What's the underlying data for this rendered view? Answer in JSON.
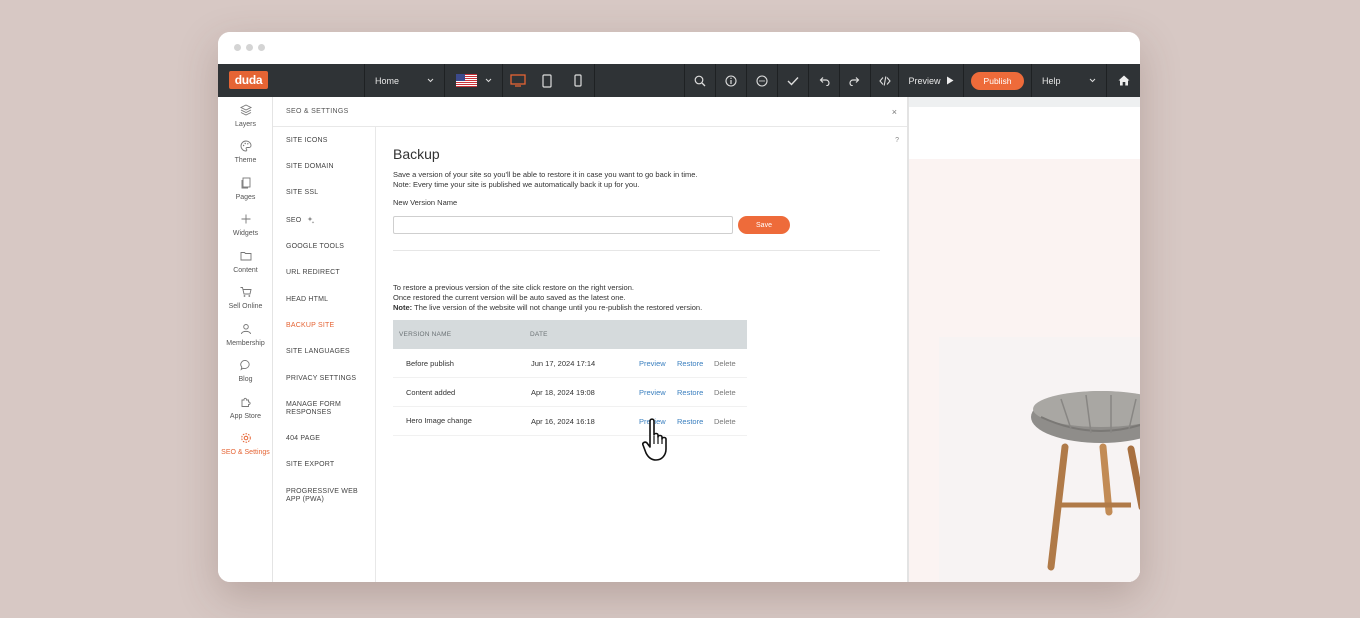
{
  "app": {
    "logo_text": "duda",
    "brand_color": "#e56434",
    "toolbar_bg": "#2f3336"
  },
  "toolbar": {
    "page_select": "Home",
    "language_flag": "us-flag-icon",
    "devices": [
      "desktop-icon",
      "tablet-icon",
      "mobile-icon"
    ],
    "preview_label": "Preview",
    "publish_label": "Publish",
    "help_label": "Help"
  },
  "sidebar": {
    "items": [
      {
        "label": "Layers",
        "icon": "layers-icon"
      },
      {
        "label": "Theme",
        "icon": "palette-icon"
      },
      {
        "label": "Pages",
        "icon": "pages-icon"
      },
      {
        "label": "Widgets",
        "icon": "plus-icon"
      },
      {
        "label": "Content",
        "icon": "folder-icon"
      },
      {
        "label": "Sell Online",
        "icon": "cart-icon"
      },
      {
        "label": "Membership",
        "icon": "user-icon"
      },
      {
        "label": "Blog",
        "icon": "chat-icon"
      },
      {
        "label": "App Store",
        "icon": "puzzle-icon"
      },
      {
        "label": "SEO & Settings",
        "icon": "gear-icon",
        "active": true
      }
    ]
  },
  "settings": {
    "title": "SEO & SETTINGS",
    "close": "×",
    "nav": [
      "SITE ICONS",
      "SITE DOMAIN",
      "SITE SSL",
      "SEO",
      "GOOGLE TOOLS",
      "URL REDIRECT",
      "HEAD HTML",
      "BACKUP SITE",
      "SITE LANGUAGES",
      "PRIVACY SETTINGS",
      "MANAGE FORM RESPONSES",
      "404 PAGE",
      "SITE EXPORT",
      "PROGRESSIVE WEB APP (PWA)"
    ],
    "active_nav": "BACKUP SITE"
  },
  "backup": {
    "help": "?",
    "title": "Backup",
    "intro_line1": "Save a version of your site so you'll be able to restore it in case you want to go back in time.",
    "intro_line2": "Note: Every time your site is published we automatically back it up for you.",
    "new_version_label": "New Version Name",
    "new_version_value": "",
    "save_label": "Save",
    "restore_line1": "To restore a previous version of the site click restore on the right version.",
    "restore_line2": "Once restored the current version will be auto saved as the latest one.",
    "note_bold": "Note:",
    "note_rest": " The live version of the website will not change until you re-publish the restored version.",
    "columns": [
      "VERSION NAME",
      "DATE"
    ],
    "rows": [
      {
        "name": "Before publish",
        "date": "Jun 17, 2024 17:14",
        "preview": "Preview",
        "restore": "Restore",
        "delete": "Delete"
      },
      {
        "name": "Content added",
        "date": "Apr 18, 2024 19:08",
        "preview": "Preview",
        "restore": "Restore",
        "delete": "Delete"
      },
      {
        "name": "Hero Image change",
        "date": "Apr 16, 2024 16:18",
        "preview": "Preview",
        "restore": "Restore",
        "delete": "Delete"
      }
    ]
  }
}
